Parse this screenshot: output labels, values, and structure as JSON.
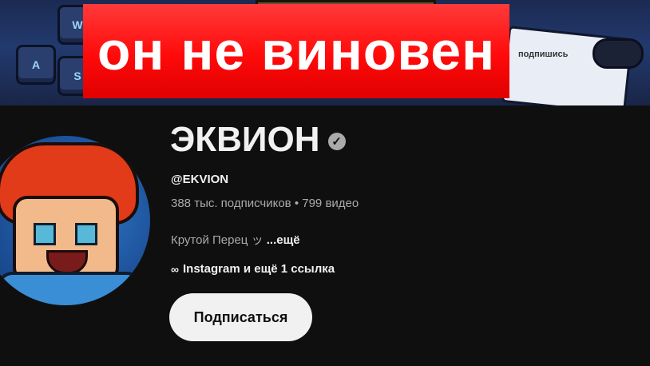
{
  "overlay": {
    "title": "он не виновен"
  },
  "banner": {
    "keys": [
      "W",
      "A",
      "S"
    ],
    "pad_text": "подпишись"
  },
  "channel": {
    "name": "ЭКВИОН",
    "verified_icon": "check-circle-icon",
    "handle": "@EKVION",
    "subscribers": "388 тыс. подписчиков",
    "separator": "•",
    "videos": "799 видео",
    "description": "Крутой Перец ッ",
    "more_label": "...ещё",
    "links_label": "Instagram и ещё 1 ссылка",
    "link_icon": "link-icon"
  },
  "actions": {
    "subscribe_label": "Подписаться"
  },
  "colors": {
    "background": "#0f0f0f",
    "overlay_red": "#ff0a0a",
    "subscribe_bg": "#f1f1f1",
    "secondary_text": "#aaaaaa"
  }
}
